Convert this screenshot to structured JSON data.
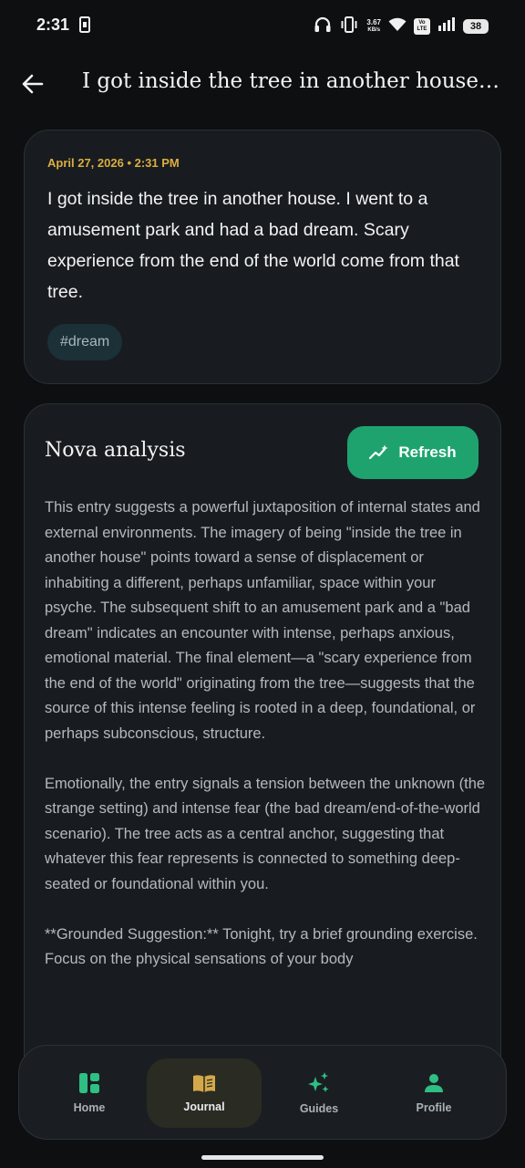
{
  "status": {
    "time": "2:31",
    "net_speed_value": "3.67",
    "net_speed_unit": "KB/s",
    "volte_top": "Vo",
    "volte_bottom": "LTE",
    "battery": "38"
  },
  "header": {
    "title": "I got inside the tree in another house. I we..."
  },
  "entry": {
    "date": "April 27, 2026 • 2:31 PM",
    "text": "I got inside the tree in another house. I went to a amusement park and had a bad dream. Scary experience from the end of the world come from that tree.",
    "tag": "#dream"
  },
  "analysis": {
    "title": "Nova analysis",
    "refresh_label": "Refresh",
    "paragraphs": [
      "This entry suggests a powerful juxtaposition of internal states and external environments. The imagery of being \"inside the tree in another house\" points toward a sense of displacement or inhabiting a different, perhaps unfamiliar, space within your psyche. The subsequent shift to an amusement park and a \"bad dream\" indicates an encounter with intense, perhaps anxious, emotional material. The final element—a \"scary experience from the end of the world\" originating from the tree—suggests that the source of this intense feeling is rooted in a deep, foundational, or perhaps subconscious, structure.",
      "Emotionally, the entry signals a tension between the unknown (the strange setting) and intense fear (the bad dream/end-of-the-world scenario). The tree acts as a central anchor, suggesting that whatever this fear represents is connected to something deep-seated or foundational within you.",
      "**Grounded Suggestion:** Tonight, try a brief grounding exercise. Focus on the physical sensations of your body"
    ]
  },
  "nav": {
    "items": [
      {
        "label": "Home",
        "icon": "dashboard-icon"
      },
      {
        "label": "Journal",
        "icon": "book-icon",
        "active": true
      },
      {
        "label": "Guides",
        "icon": "sparkles-icon"
      },
      {
        "label": "Profile",
        "icon": "person-icon"
      }
    ]
  },
  "colors": {
    "background": "#0d0f11",
    "card": "#181c20",
    "accent_green": "#1ea36f",
    "date_gold": "#d9ae3f",
    "journal_icon_gold": "#d4a84a",
    "tag_bg": "#1c3037"
  }
}
